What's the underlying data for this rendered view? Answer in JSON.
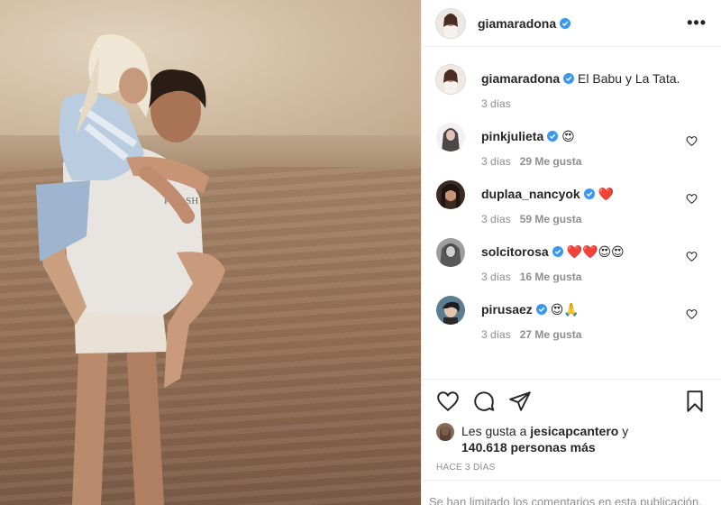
{
  "colors": {
    "verified": "#3897f0",
    "text": "#262626",
    "muted": "#8e8e8e",
    "heart": "#ed4956"
  },
  "post": {
    "username": "giamaradona",
    "caption": "El Babu y La Tata.",
    "caption_time": "3 días",
    "more_label": "•••"
  },
  "comments": [
    {
      "user": "pinkjulieta",
      "emoji": "😍",
      "time": "3 días",
      "likes": "29 Me gusta"
    },
    {
      "user": "duplaa_nancyok",
      "emoji": "❤️",
      "time": "3 días",
      "likes": "59 Me gusta"
    },
    {
      "user": "solcitorosa",
      "emoji": "❤️❤️😍😍",
      "time": "3 días",
      "likes": "16 Me gusta"
    },
    {
      "user": "pirusaez",
      "emoji": "😍🙏",
      "time": "3 días",
      "likes": "27 Me gusta"
    }
  ],
  "likes_block": {
    "prefix": "Les gusta a",
    "user": "jesicapcantero",
    "and": "y",
    "count": "140.618 personas más"
  },
  "posted": "HACE 3 DÍAS",
  "limited_comments": "Se han limitado los comentarios en esta publicación."
}
